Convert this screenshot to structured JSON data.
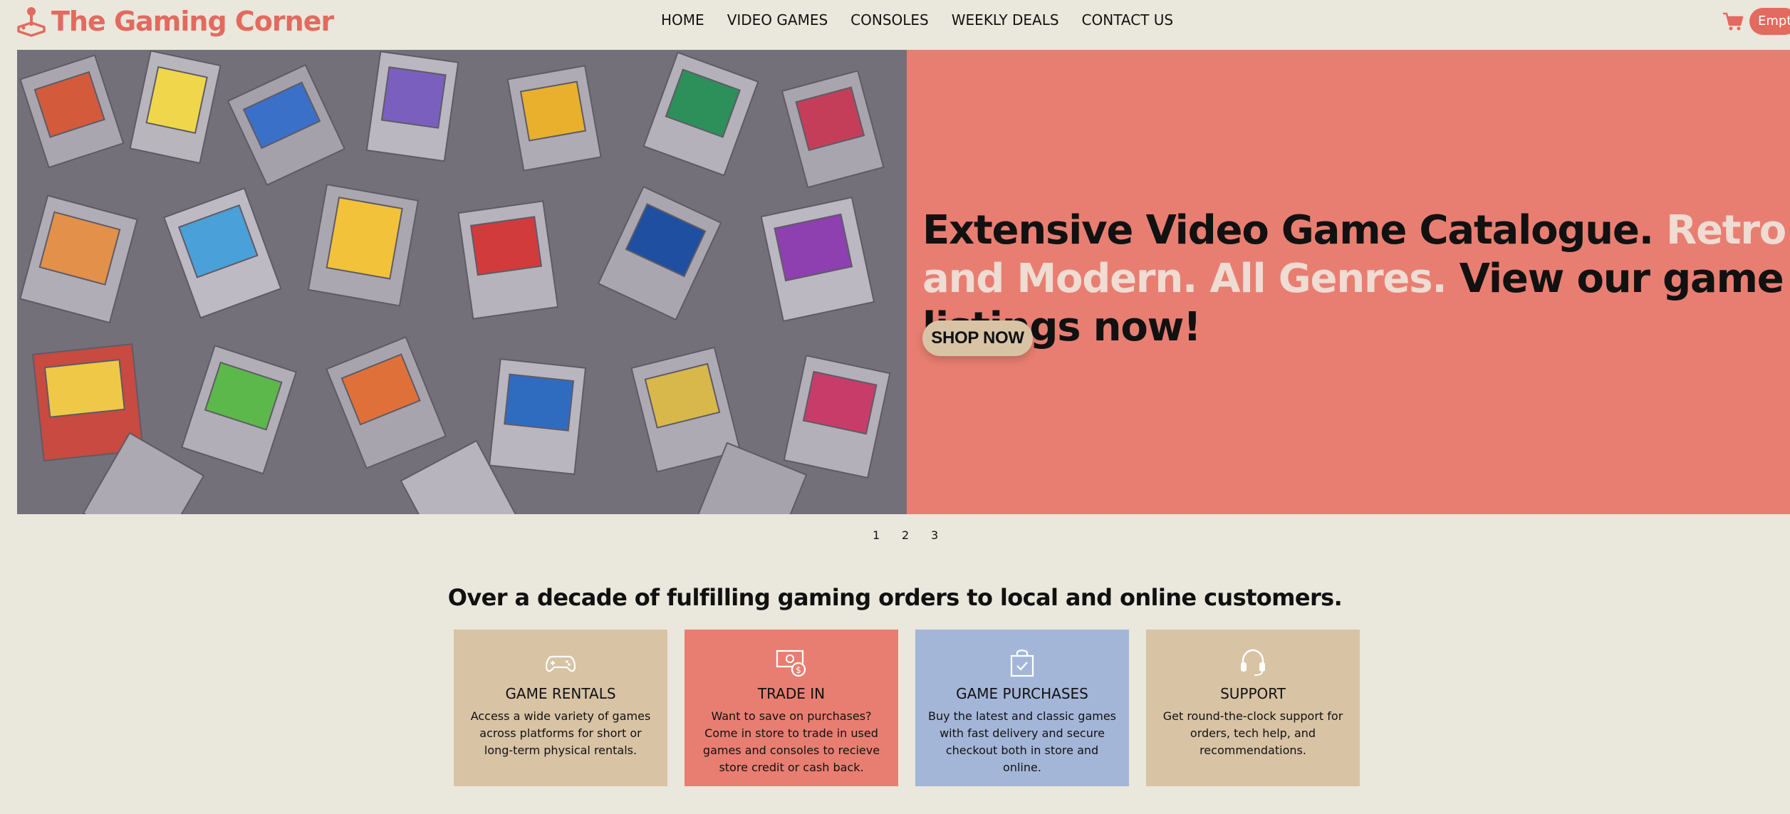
{
  "brand": {
    "name": "The Gaming Corner",
    "color": "#e26a5f"
  },
  "nav": {
    "items": [
      "HOME",
      "VIDEO GAMES",
      "CONSOLES",
      "WEEKLY DEALS",
      "CONTACT US"
    ]
  },
  "cart": {
    "icon": "shopping-cart-icon",
    "status": "Empty"
  },
  "hero": {
    "image": "pile-of-retro-game-cartridges",
    "headline_part1": "Extensive Video Game Catalogue.",
    "headline_part2": "Retro and Modern. All Genres.",
    "headline_part3": "View our game listings now!",
    "cta_label": "SHOP NOW",
    "panel_color": "#e87e71"
  },
  "slider": {
    "pages": [
      "1",
      "2",
      "3"
    ]
  },
  "tagline": "Over a decade of fulfilling gaming orders to local and online customers.",
  "services": [
    {
      "icon": "gamepad-icon",
      "title": "GAME RENTALS",
      "description": "Access a wide variety of games across platforms for short or long-term physical rentals.",
      "color": "#d8c3a5"
    },
    {
      "icon": "money-exchange-icon",
      "title": "TRADE IN",
      "description": "Want to save on purchases? Come in store to trade in used games and consoles to recieve store credit or cash back.",
      "color": "#e87e71"
    },
    {
      "icon": "shopping-bag-check-icon",
      "title": "GAME PURCHASES",
      "description": "Buy the latest and classic games with fast delivery and secure checkout both in store and online.",
      "color": "#a4b6d8"
    },
    {
      "icon": "headset-icon",
      "title": "SUPPORT",
      "description": "Get round-the-clock support for orders, tech help, and recommendations.",
      "color": "#d8c3a5"
    }
  ]
}
